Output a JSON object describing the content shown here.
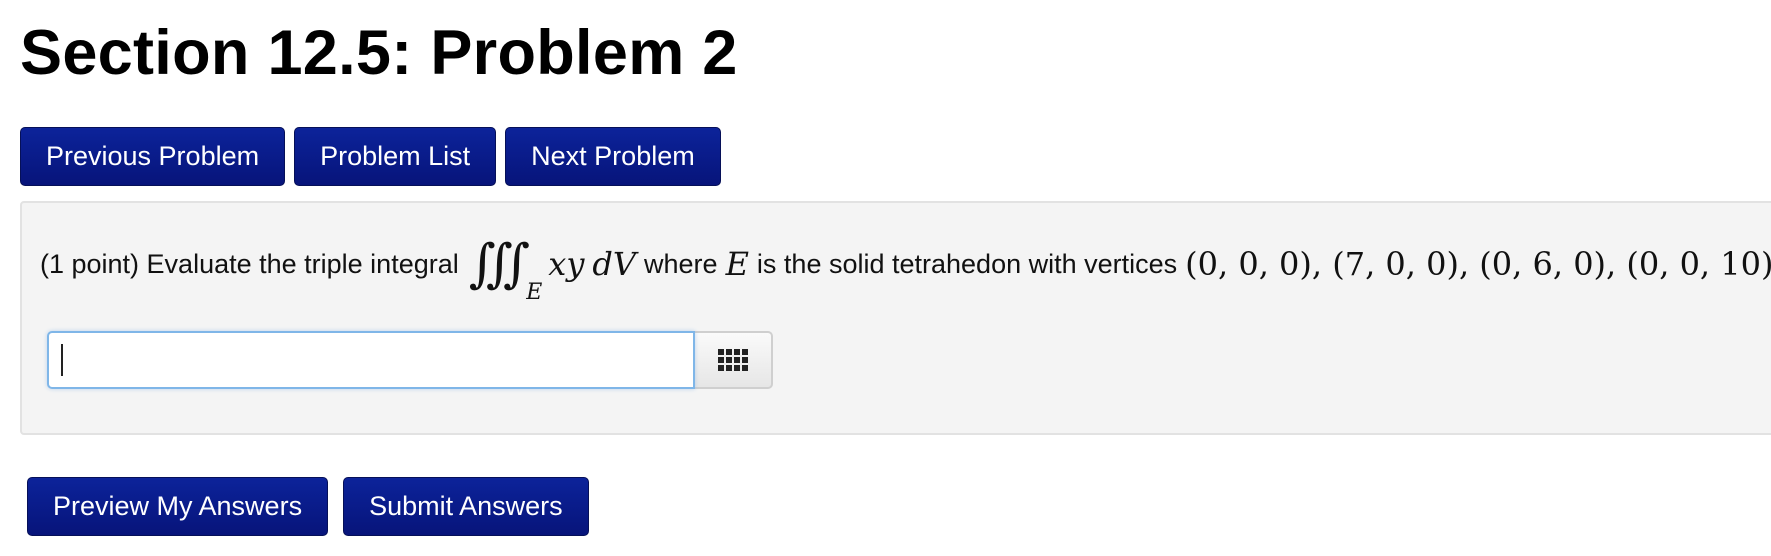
{
  "page": {
    "title": "Section 12.5: Problem 2"
  },
  "nav": {
    "previous_label": "Previous Problem",
    "list_label": "Problem List",
    "next_label": "Next Problem"
  },
  "problem": {
    "points_prefix": "(1 point) Evaluate the triple integral",
    "integral_signs": "∭",
    "integral_subscript": "E",
    "integrand": "xy",
    "differential_d": "d",
    "differential_v": "V",
    "where_text": "where",
    "region": "E",
    "description": "is the solid tetrahedon with vertices",
    "vertices": "(0, 0, 0), (7, 0, 0), (0, 6, 0), (0, 0, 10)",
    "end_period": "."
  },
  "answer": {
    "value": "",
    "placeholder": "",
    "keypad_icon": "grid-icon"
  },
  "actions": {
    "preview_label": "Preview My Answers",
    "submit_label": "Submit Answers"
  },
  "colors": {
    "button_bg": "#07147a",
    "box_bg": "#f4f4f4",
    "input_border": "#7fb6e8"
  }
}
